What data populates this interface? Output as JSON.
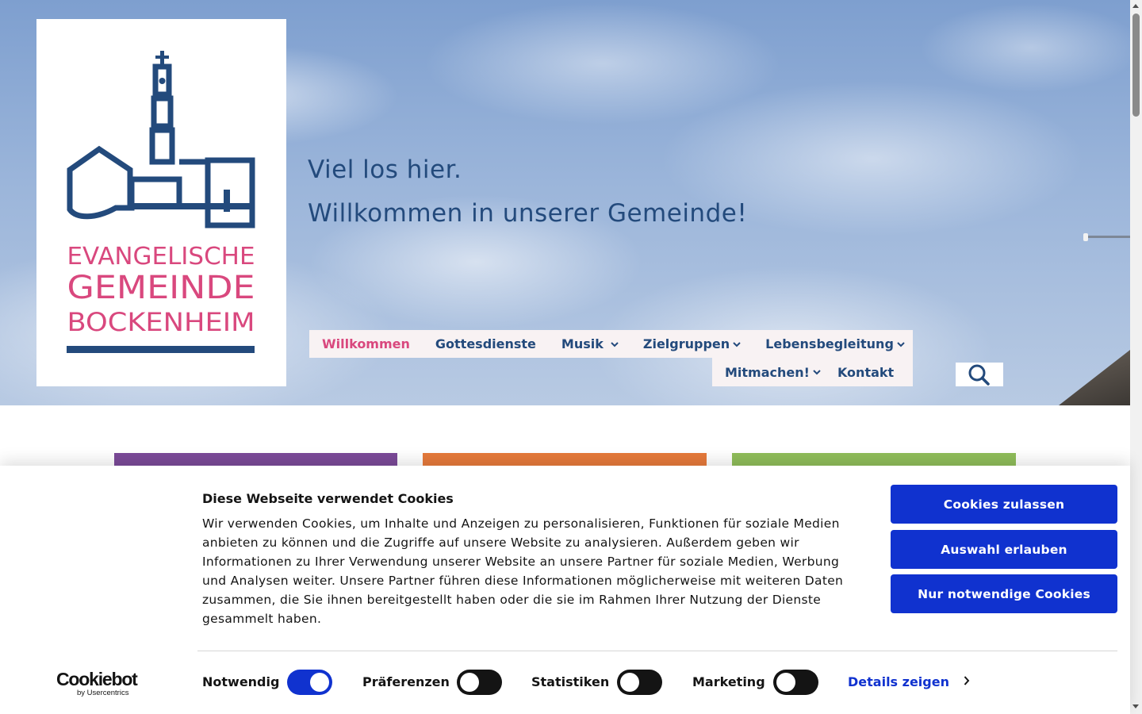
{
  "logo": {
    "line1": "EVANGELISCHE",
    "line2": "GEMEINDE",
    "line3": "BOCKENHEIM",
    "colors": {
      "blue": "#234a7c",
      "pink": "#d9487e"
    }
  },
  "hero": {
    "tagline_1": "Viel los hier.",
    "tagline_2": "Willkommen in unserer Gemeinde!"
  },
  "nav": {
    "items": [
      {
        "label": "Willkommen",
        "active": true,
        "dropdown": false
      },
      {
        "label": "Gottesdienste",
        "active": false,
        "dropdown": false
      },
      {
        "label": "Musik",
        "active": false,
        "dropdown": true
      },
      {
        "label": "Zielgruppen",
        "active": false,
        "dropdown": true
      },
      {
        "label": "Lebensbegleitung",
        "active": false,
        "dropdown": true
      },
      {
        "label": "Mitmachen!",
        "active": false,
        "dropdown": true
      },
      {
        "label": "Kontakt",
        "active": false,
        "dropdown": false
      }
    ],
    "search_icon": "search-icon"
  },
  "tiles": {
    "colors": [
      "#7b4a98",
      "#e67a3b",
      "#8fbd5a"
    ]
  },
  "cookie": {
    "title": "Diese Webseite verwendet Cookies",
    "text": "Wir verwenden Cookies, um Inhalte und Anzeigen zu personalisieren, Funktionen für soziale Medien anbieten zu können und die Zugriffe auf unsere Website zu analysieren. Außerdem geben wir Informationen zu Ihrer Verwendung unserer Website an unsere Partner für soziale Medien, Werbung und Analysen weiter. Unsere Partner führen diese Informationen möglicherweise mit weiteren Daten zusammen, die Sie ihnen bereitgestellt haben oder die sie im Rahmen Ihrer Nutzung der Dienste gesammelt haben.",
    "buttons": {
      "allow_all": "Cookies zulassen",
      "allow_selection": "Auswahl erlauben",
      "necessary_only": "Nur notwendige Cookies"
    },
    "brand": {
      "name": "Cookiebot",
      "sub": "by Usercentrics"
    },
    "toggles": [
      {
        "label": "Notwendig",
        "on": true
      },
      {
        "label": "Präferenzen",
        "on": false
      },
      {
        "label": "Statistiken",
        "on": false
      },
      {
        "label": "Marketing",
        "on": false
      }
    ],
    "details_link": "Details zeigen",
    "accent_color": "#1032cf"
  }
}
